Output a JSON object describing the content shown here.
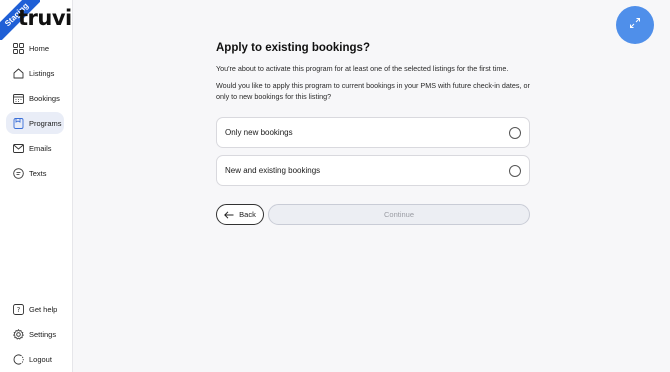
{
  "badge": {
    "text": "Staging"
  },
  "brand": {
    "logo_text": "truvi"
  },
  "sidebar": {
    "items": [
      {
        "label": "Home",
        "icon": "grid-icon"
      },
      {
        "label": "Listings",
        "icon": "house-icon"
      },
      {
        "label": "Bookings",
        "icon": "calendar-icon"
      },
      {
        "label": "Programs",
        "icon": "document-icon",
        "active": true
      },
      {
        "label": "Emails",
        "icon": "mail-icon"
      },
      {
        "label": "Texts",
        "icon": "chat-icon"
      }
    ],
    "bottom_items": [
      {
        "label": "Get help",
        "icon": "help-icon"
      },
      {
        "label": "Settings",
        "icon": "gear-icon"
      },
      {
        "label": "Logout",
        "icon": "logout-icon"
      }
    ]
  },
  "main": {
    "title": "Apply to existing bookings?",
    "description_1": "You're about to activate this program for at least one of the selected listings for the first time.",
    "description_2": "Would you like to apply this program to current bookings in your PMS with future check-in dates, or only to new bookings for this listing?",
    "options": [
      {
        "label": "Only new bookings",
        "selected": false
      },
      {
        "label": "New and existing bookings",
        "selected": false
      }
    ],
    "back_label": "Back",
    "continue_label": "Continue"
  },
  "colors": {
    "accent": "#4f8fea",
    "badge": "#1f5fd6",
    "active_nav": "#e9edf7"
  }
}
